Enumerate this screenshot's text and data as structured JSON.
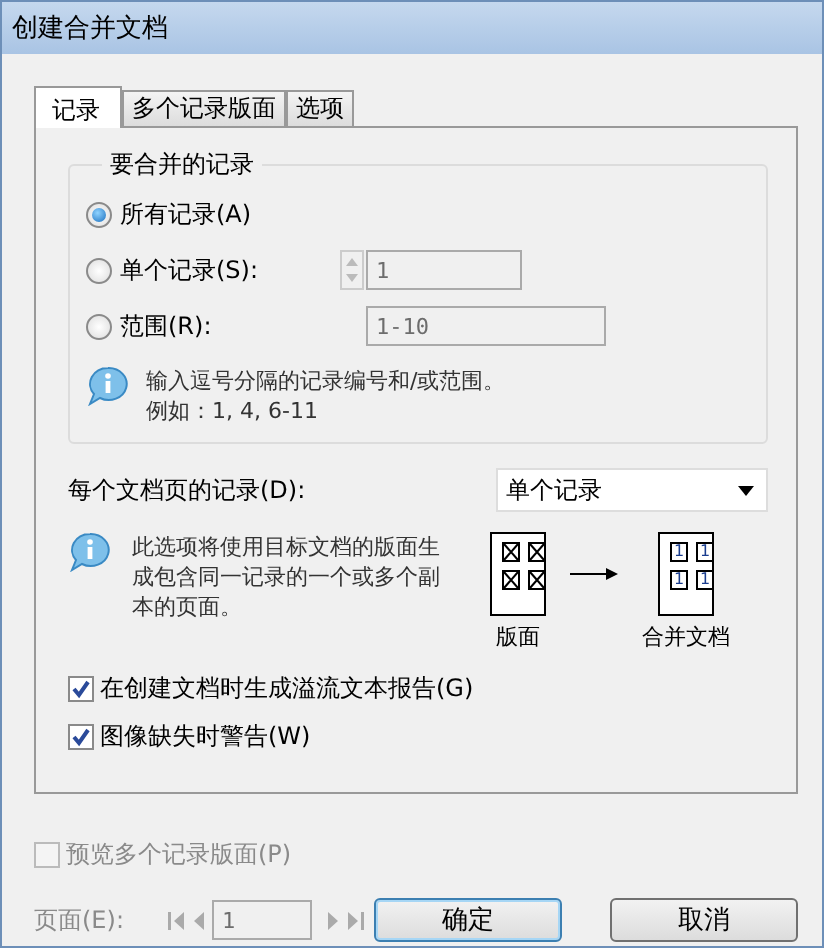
{
  "window": {
    "title": "创建合并文档"
  },
  "tabs": [
    {
      "label": "记录",
      "selected": true
    },
    {
      "label": "多个记录版面",
      "selected": false
    },
    {
      "label": "选项",
      "selected": false
    }
  ],
  "records_group": {
    "title": "要合并的记录",
    "options": [
      {
        "label": "所有记录(A)",
        "selected": true
      },
      {
        "label": "单个记录(S):",
        "selected": false,
        "field": {
          "kind": "spinner",
          "value": "1",
          "disabled": true
        }
      },
      {
        "label": "范围(R):",
        "selected": false,
        "field": {
          "kind": "text",
          "value": "1-10",
          "disabled": true
        }
      }
    ],
    "info": [
      "输入逗号分隔的记录编号和/或范围。",
      "例如：1, 4, 6-11"
    ]
  },
  "per_page": {
    "label": "每个文档页的记录(D):",
    "value": "单个记录"
  },
  "per_page_info": "此选项将使用目标文档的版面生成包含同一记录的一个或多个副本的页面。",
  "diagram": {
    "source_label": "版面",
    "result_label": "合并文档",
    "result_cells": [
      "1",
      "1",
      "1",
      "1"
    ]
  },
  "checkboxes": [
    {
      "label": "在创建文档时生成溢流文本报告(G)",
      "checked": true
    },
    {
      "label": "图像缺失时警告(W)",
      "checked": true
    }
  ],
  "preview": {
    "label": "预览多个记录版面(P)",
    "checked": false,
    "disabled": true
  },
  "page": {
    "label": "页面(E):",
    "value": "1",
    "disabled": true
  },
  "buttons": [
    {
      "label": "确定",
      "default": true
    },
    {
      "label": "取消",
      "default": false
    }
  ]
}
